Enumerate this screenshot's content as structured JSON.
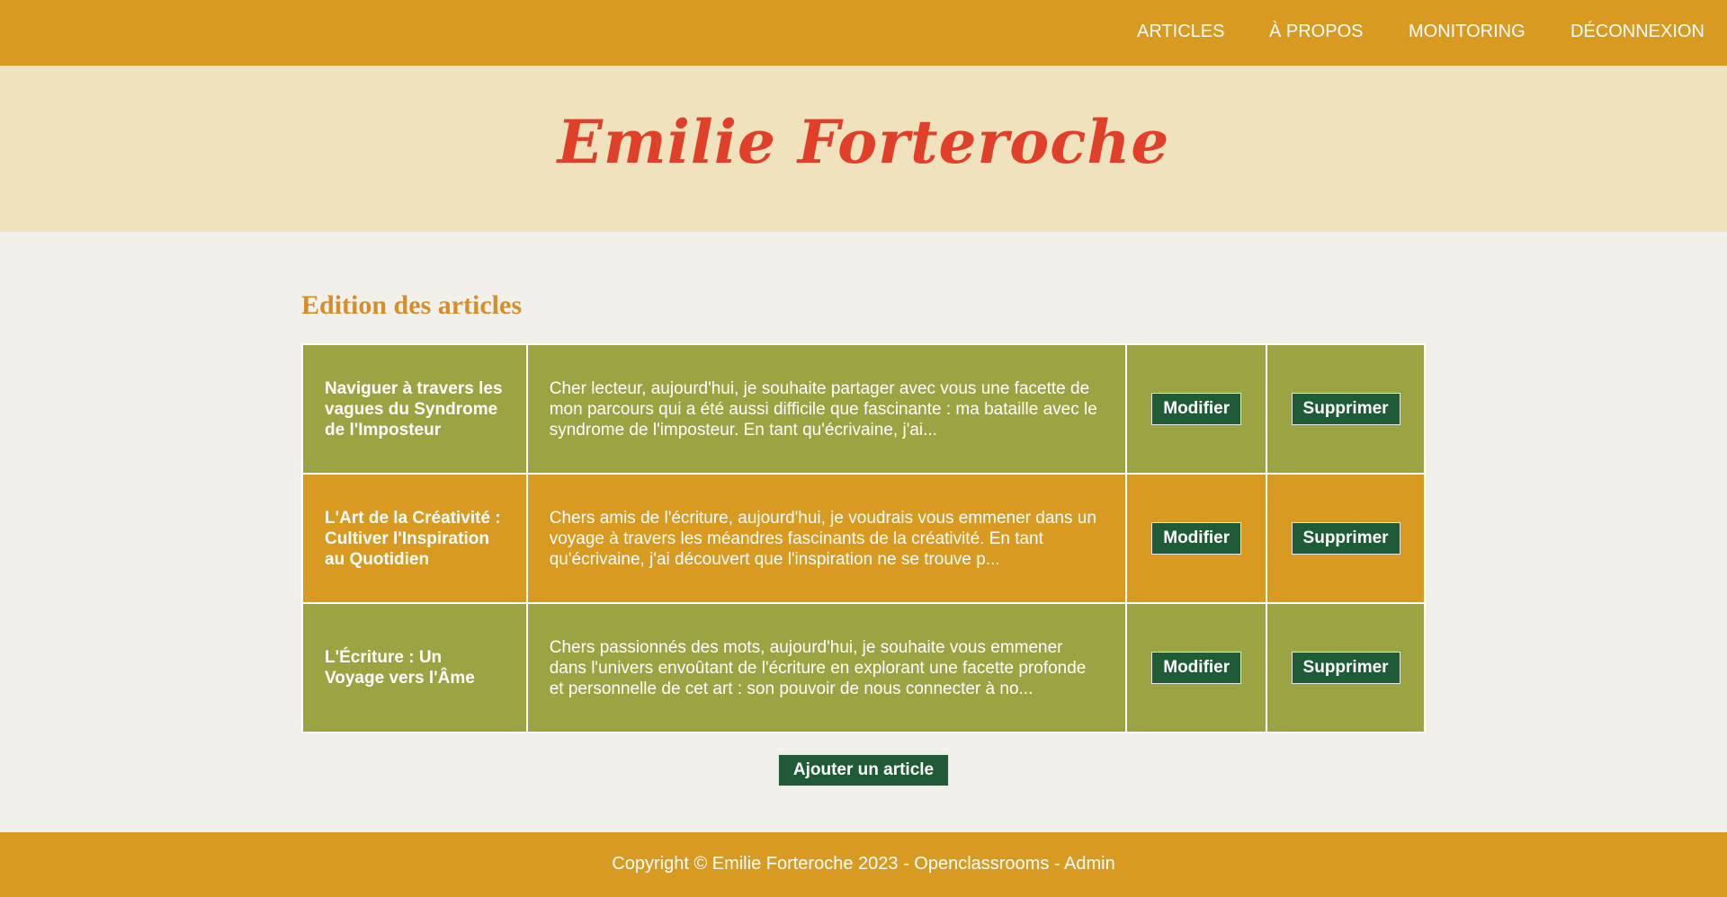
{
  "nav": {
    "items": [
      {
        "label": "ARTICLES"
      },
      {
        "label": "À PROPOS"
      },
      {
        "label": "MONITORING"
      },
      {
        "label": "DÉCONNEXION"
      }
    ]
  },
  "hero": {
    "title": "Emilie Forteroche"
  },
  "main": {
    "heading": "Edition des articles",
    "articles": [
      {
        "title": "Naviguer à travers les vagues du Syndrome de l'Imposteur",
        "excerpt": "Cher lecteur, aujourd'hui, je souhaite partager avec vous une facette de mon parcours qui a été aussi difficile que fascinante : ma bataille avec le syndrome de l'imposteur. En tant qu'écrivaine, j'ai...",
        "edit_label": "Modifier",
        "delete_label": "Supprimer"
      },
      {
        "title": "L'Art de la Créativité : Cultiver l'Inspiration au Quotidien",
        "excerpt": "Chers amis de l'écriture, aujourd'hui, je voudrais vous emmener dans un voyage à travers les méandres fascinants de la créativité. En tant qu'écrivaine, j'ai découvert que l'inspiration ne se trouve p...",
        "edit_label": "Modifier",
        "delete_label": "Supprimer"
      },
      {
        "title": "L'Écriture : Un Voyage vers l'Âme",
        "excerpt": "Chers passionnés des mots, aujourd'hui, je souhaite vous emmener dans l'univers envoûtant de l'écriture en explorant une facette profonde et personnelle de cet art : son pouvoir de nous connecter à no...",
        "edit_label": "Modifier",
        "delete_label": "Supprimer"
      }
    ],
    "add_label": "Ajouter un article"
  },
  "footer": {
    "copyright": "Copyright © Emilie Forteroche 2023 - Openclassrooms - Admin"
  },
  "colors": {
    "header_bg": "#d89a21",
    "hero_bg": "#efe2bc",
    "title_red": "#e0402a",
    "heading_orange": "#d48f2c",
    "row_olive": "#9ba343",
    "row_orange": "#d89a21",
    "button_green": "#1f5b36",
    "main_bg": "#f1f0eb"
  }
}
